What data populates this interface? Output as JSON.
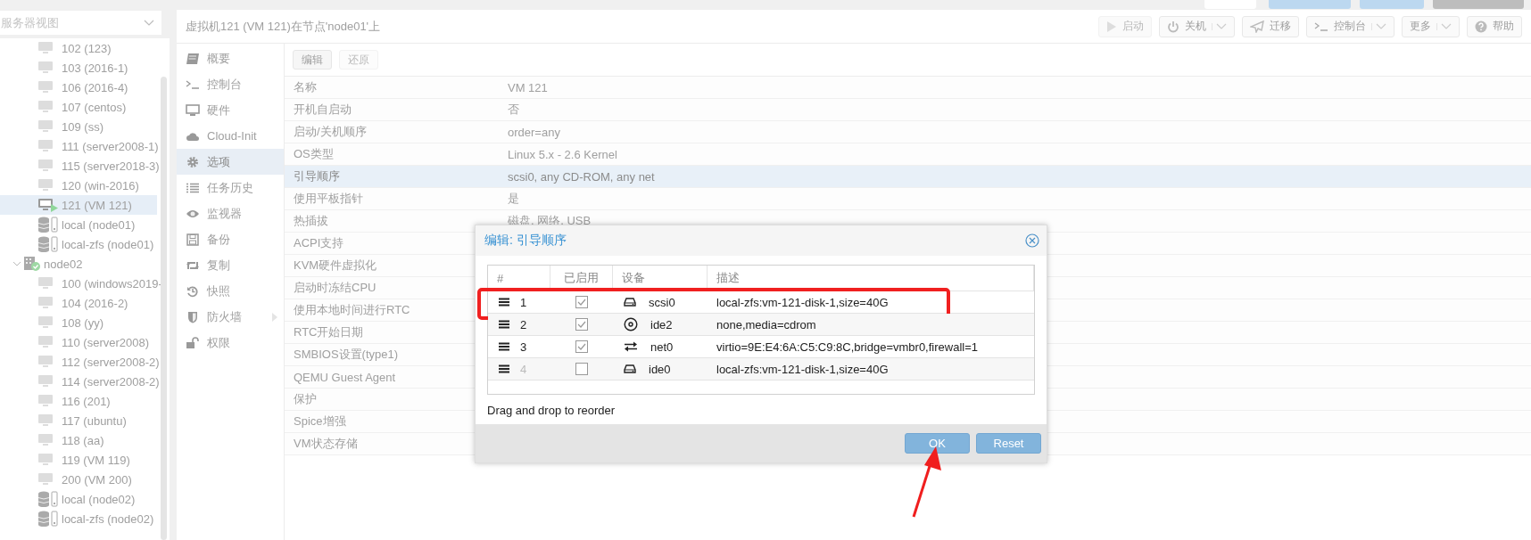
{
  "tree": {
    "view_select": "服务器视图",
    "groups": [
      {
        "children": [
          {
            "kind": "vm",
            "label": "102 (123)",
            "selected": false
          },
          {
            "kind": "vm",
            "label": "103 (2016-1)",
            "selected": false
          },
          {
            "kind": "vm",
            "label": "106 (2016-4)",
            "selected": false
          },
          {
            "kind": "vm",
            "label": "107 (centos)",
            "selected": false
          },
          {
            "kind": "vm",
            "label": "109 (ss)",
            "selected": false
          },
          {
            "kind": "vm",
            "label": "111 (server2008-1)",
            "selected": false
          },
          {
            "kind": "vm",
            "label": "115 (server2018-3)",
            "selected": false
          },
          {
            "kind": "vm",
            "label": "120 (win-2016)",
            "selected": false
          },
          {
            "kind": "vm_running",
            "label": "121 (VM 121)",
            "selected": true
          },
          {
            "kind": "storage",
            "label": "local (node01)",
            "selected": false
          },
          {
            "kind": "storage",
            "label": "local-zfs (node01)",
            "selected": false
          }
        ]
      },
      {
        "label": "node02",
        "expanded": true,
        "children": [
          {
            "kind": "vm",
            "label": "100 (windows2019-",
            "selected": false
          },
          {
            "kind": "vm",
            "label": "104 (2016-2)",
            "selected": false
          },
          {
            "kind": "vm",
            "label": "108 (yy)",
            "selected": false
          },
          {
            "kind": "vm",
            "label": "110 (server2008)",
            "selected": false
          },
          {
            "kind": "vm",
            "label": "112 (server2008-2)",
            "selected": false
          },
          {
            "kind": "vm",
            "label": "114 (server2008-2)",
            "selected": false
          },
          {
            "kind": "vm",
            "label": "116 (201)",
            "selected": false
          },
          {
            "kind": "vm",
            "label": "117 (ubuntu)",
            "selected": false
          },
          {
            "kind": "vm",
            "label": "118 (aa)",
            "selected": false
          },
          {
            "kind": "vm",
            "label": "119 (VM 119)",
            "selected": false
          },
          {
            "kind": "vm",
            "label": "200 (VM 200)",
            "selected": false
          },
          {
            "kind": "storage",
            "label": "local (node02)",
            "selected": false
          },
          {
            "kind": "storage",
            "label": "local-zfs (node02)",
            "selected": false
          }
        ]
      }
    ]
  },
  "header": {
    "title": "虚拟机121 (VM 121)在节点'node01'上"
  },
  "toolbar": [
    {
      "kind": "play",
      "label": "启动",
      "dropdown": false,
      "disabled": true
    },
    {
      "kind": "power",
      "label": "关机",
      "dropdown": true,
      "disabled": false
    },
    {
      "kind": "send",
      "label": "迁移",
      "dropdown": false,
      "disabled": false
    },
    {
      "kind": "terminal",
      "label": "控制台",
      "dropdown": true,
      "disabled": false
    },
    {
      "kind": "plain",
      "label": "更多",
      "dropdown": true,
      "disabled": false
    },
    {
      "kind": "help",
      "label": "帮助",
      "dropdown": false,
      "disabled": false
    }
  ],
  "nav": [
    {
      "kind": "book",
      "label": "概要",
      "selected": false,
      "submenu": false
    },
    {
      "kind": "terminal",
      "label": "控制台",
      "selected": false,
      "submenu": false
    },
    {
      "kind": "monitor",
      "label": "硬件",
      "selected": false,
      "submenu": false
    },
    {
      "kind": "cloud",
      "label": "Cloud-Init",
      "selected": false,
      "submenu": false
    },
    {
      "kind": "gear",
      "label": "选项",
      "selected": true,
      "submenu": false
    },
    {
      "kind": "list",
      "label": "任务历史",
      "selected": false,
      "submenu": false
    },
    {
      "kind": "eye",
      "label": "监视器",
      "selected": false,
      "submenu": false
    },
    {
      "kind": "save",
      "label": "备份",
      "selected": false,
      "submenu": false
    },
    {
      "kind": "retweet",
      "label": "复制",
      "selected": false,
      "submenu": false
    },
    {
      "kind": "history",
      "label": "快照",
      "selected": false,
      "submenu": false
    },
    {
      "kind": "shield",
      "label": "防火墙",
      "selected": false,
      "submenu": true
    },
    {
      "kind": "unlock",
      "label": "权限",
      "selected": false,
      "submenu": false
    }
  ],
  "options": {
    "buttons": [
      {
        "label": "编辑",
        "disabled": false
      },
      {
        "label": "还原",
        "disabled": true
      }
    ],
    "rows": [
      {
        "label": "名称",
        "value": "VM 121",
        "selected": false
      },
      {
        "label": "开机自启动",
        "value": "否",
        "selected": false
      },
      {
        "label": "启动/关机顺序",
        "value": "order=any",
        "selected": false
      },
      {
        "label": "OS类型",
        "value": "Linux 5.x - 2.6 Kernel",
        "selected": false
      },
      {
        "label": "引导顺序",
        "value": "scsi0, any CD-ROM, any net",
        "selected": true
      },
      {
        "label": "使用平板指针",
        "value": "是",
        "selected": false
      },
      {
        "label": "热插拔",
        "value": "磁盘, 网络, USB",
        "selected": false
      },
      {
        "label": "ACPI支持",
        "selected": false
      },
      {
        "label": "KVM硬件虚拟化",
        "selected": false
      },
      {
        "label": "启动时冻结CPU",
        "selected": false
      },
      {
        "label": "使用本地时间进行RTC",
        "selected": false
      },
      {
        "label": "RTC开始日期",
        "selected": false
      },
      {
        "label": "SMBIOS设置(type1)",
        "selected": false
      },
      {
        "label": "QEMU Guest Agent",
        "selected": false
      },
      {
        "label": "保护",
        "selected": false
      },
      {
        "label": "Spice增强",
        "selected": false
      },
      {
        "label": "VM状态存储",
        "selected": false
      }
    ]
  },
  "dialog": {
    "title": "编辑: 引导顺序",
    "columns": [
      "#",
      "已启用",
      "设备",
      "描述"
    ],
    "rows": [
      {
        "order": "1",
        "enabled": true,
        "kind": "disk",
        "device": "scsi0",
        "description": "local-zfs:vm-121-disk-1,size=40G",
        "highlighted": true
      },
      {
        "order": "2",
        "enabled": true,
        "kind": "cdrom",
        "device": "ide2",
        "description": "none,media=cdrom",
        "highlighted": false
      },
      {
        "order": "3",
        "enabled": true,
        "kind": "net",
        "device": "net0",
        "description": "virtio=9E:E4:6A:C5:C9:8C,bridge=vmbr0,firewall=1",
        "highlighted": false
      },
      {
        "order": "4",
        "enabled": false,
        "kind": "disk",
        "device": "ide0",
        "description": "local-zfs:vm-121-disk-1,size=40G",
        "highlighted": false
      }
    ],
    "hint": "Drag and drop to reorder",
    "buttons": [
      "OK",
      "Reset"
    ],
    "arrow_to_ok": true
  }
}
